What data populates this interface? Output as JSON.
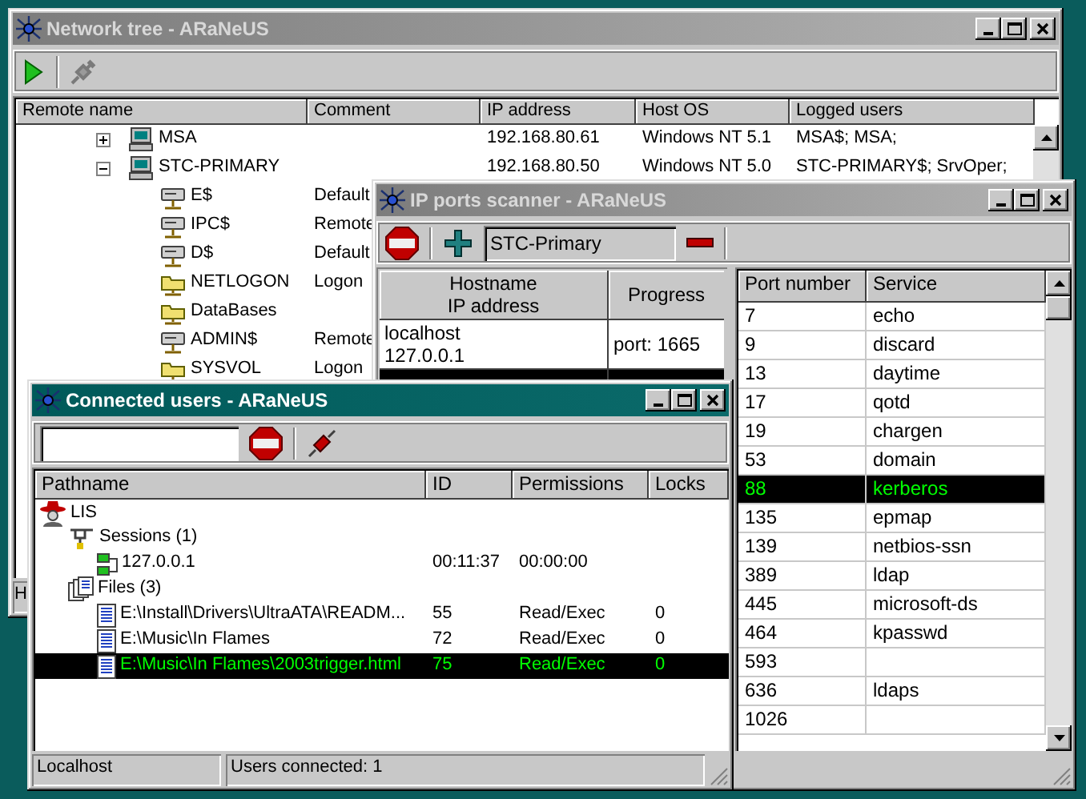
{
  "network_tree": {
    "title": "Network tree - ARaNeUS",
    "active": false,
    "columns": [
      "Remote name",
      "Comment",
      "IP address",
      "Host OS",
      "Logged users"
    ],
    "rows": [
      {
        "name": "MSA",
        "kind": "computer",
        "expanded": false,
        "selected": false,
        "ip": "192.168.80.61",
        "os": "Windows NT 5.1",
        "users": "MSA$; MSA;"
      },
      {
        "name": "STC-PRIMARY",
        "kind": "computer",
        "expanded": true,
        "selected": false,
        "ip": "192.168.80.50",
        "os": "Windows NT 5.0",
        "users": "STC-PRIMARY$; SrvOper;",
        "children": [
          {
            "name": "E$",
            "kind": "disk",
            "selected": false,
            "comment": "Default"
          },
          {
            "name": "IPC$",
            "kind": "disk",
            "selected": false,
            "comment": "Remote"
          },
          {
            "name": "D$",
            "kind": "disk",
            "selected": false,
            "comment": "Default"
          },
          {
            "name": "NETLOGON",
            "kind": "folder",
            "selected": false,
            "comment": "Logon"
          },
          {
            "name": "DataBases",
            "kind": "folder",
            "selected": false
          },
          {
            "name": "ADMIN$",
            "kind": "disk",
            "selected": false,
            "comment": "Remote"
          },
          {
            "name": "SYSVOL",
            "kind": "folder",
            "selected": false,
            "comment": "Logon"
          }
        ]
      }
    ],
    "status": "H"
  },
  "ports_scanner": {
    "title": "IP ports scanner - ARaNeUS",
    "active": false,
    "host_field": {
      "value": "STC-Primary"
    },
    "hosts": {
      "header": [
        "Hostname",
        "IP address"
      ],
      "progress_header": "Progress",
      "rows": [
        {
          "hostname": "localhost",
          "ip": "127.0.0.1",
          "progress": "port: 1665",
          "selected": false
        },
        {
          "selected": true
        }
      ]
    },
    "ports": {
      "columns": [
        "Port number",
        "Service"
      ],
      "rows": [
        {
          "port": "7",
          "service": "echo",
          "selected": false
        },
        {
          "port": "9",
          "service": "discard",
          "selected": false
        },
        {
          "port": "13",
          "service": "daytime",
          "selected": false
        },
        {
          "port": "17",
          "service": "qotd",
          "selected": false
        },
        {
          "port": "19",
          "service": "chargen",
          "selected": false
        },
        {
          "port": "53",
          "service": "domain",
          "selected": false
        },
        {
          "port": "88",
          "service": "kerberos",
          "selected": true
        },
        {
          "port": "135",
          "service": "epmap",
          "selected": false
        },
        {
          "port": "139",
          "service": "netbios-ssn",
          "selected": false
        },
        {
          "port": "389",
          "service": "ldap",
          "selected": false
        },
        {
          "port": "445",
          "service": "microsoft-ds",
          "selected": false
        },
        {
          "port": "464",
          "service": "kpasswd",
          "selected": false
        },
        {
          "port": "593",
          "selected": false
        },
        {
          "port": "636",
          "service": "ldaps",
          "selected": false
        },
        {
          "port": "1026",
          "selected": false
        }
      ]
    }
  },
  "connected_users": {
    "title": "Connected users - ARaNeUS",
    "active": true,
    "columns": [
      "Pathname",
      "ID",
      "Permissions",
      "Locks"
    ],
    "tree": [
      {
        "label": "LIS",
        "kind": "user",
        "selected": false,
        "children": [
          {
            "label": "Sessions (1)",
            "kind": "sessions",
            "selected": false,
            "children": [
              {
                "label": "127.0.0.1",
                "kind": "session",
                "selected": false,
                "id": "00:11:37",
                "permissions": "00:00:00"
              }
            ]
          },
          {
            "label": "Files (3)",
            "kind": "files",
            "selected": false,
            "children": [
              {
                "label": "E:\\Install\\Drivers\\UltraATA\\READM...",
                "kind": "file",
                "selected": false,
                "id": "55",
                "permissions": "Read/Exec",
                "locks": "0"
              },
              {
                "label": "E:\\Music\\In Flames",
                "kind": "file",
                "selected": false,
                "id": "72",
                "permissions": "Read/Exec",
                "locks": "0"
              },
              {
                "label": "E:\\Music\\In Flames\\2003trigger.html",
                "kind": "file",
                "selected": true,
                "id": "75",
                "permissions": "Read/Exec",
                "locks": "0"
              }
            ]
          }
        ]
      }
    ],
    "status": [
      "Localhost",
      "Users connected: 1"
    ]
  }
}
